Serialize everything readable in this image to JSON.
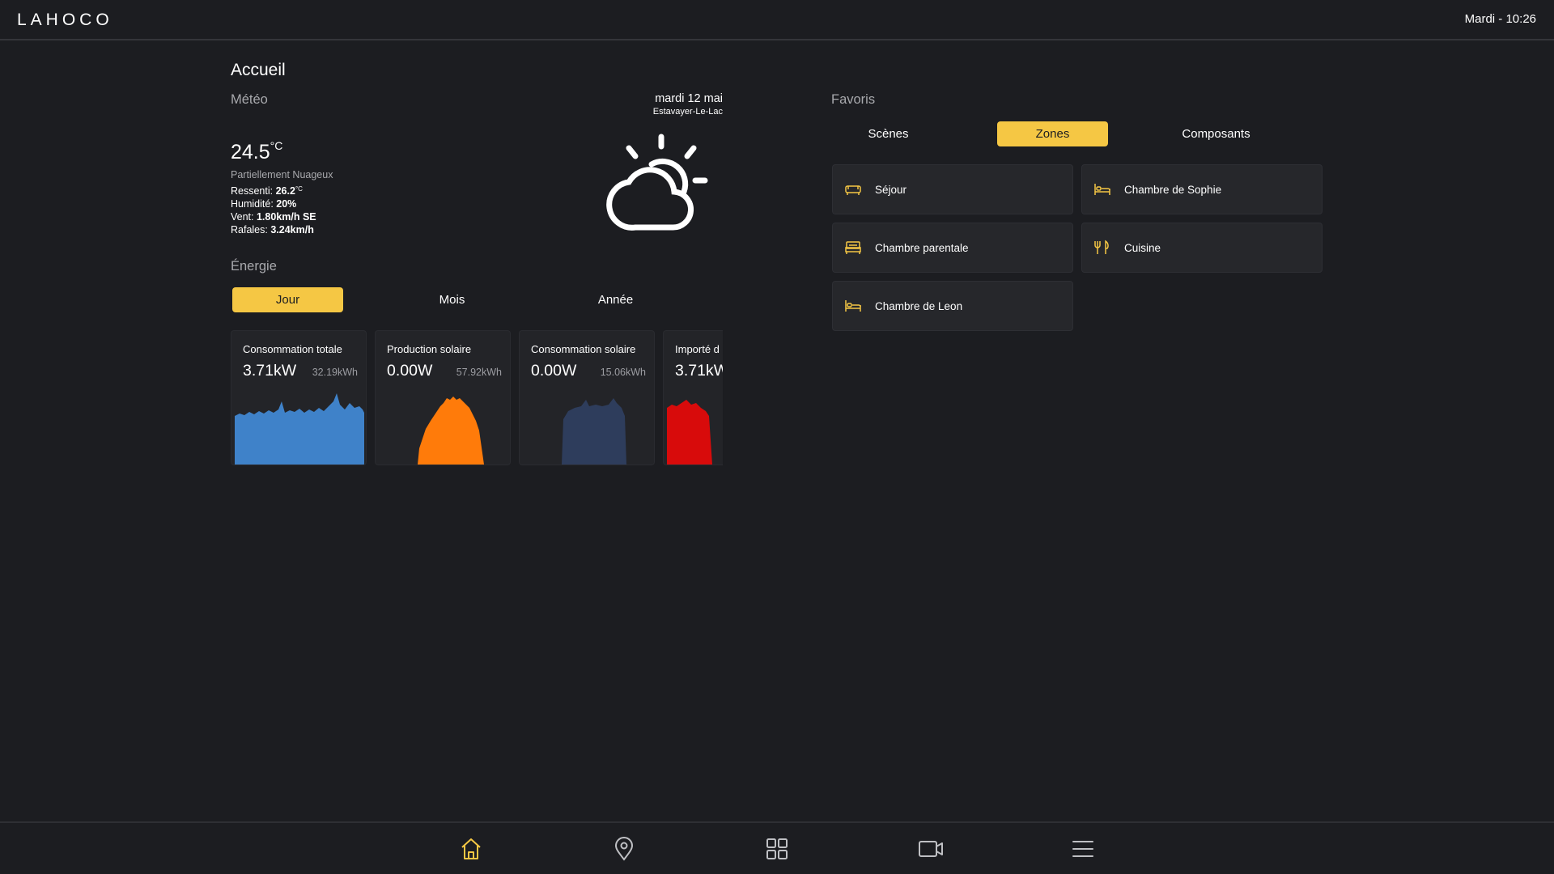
{
  "header": {
    "brand": "LAHOCO",
    "clock": "Mardi - 10:26"
  },
  "page": {
    "title": "Accueil"
  },
  "weather": {
    "section_title": "Météo",
    "date": "mardi 12 mai",
    "location": "Estavayer-Le-Lac",
    "temperature": "24.5",
    "temperature_unit": "°C",
    "description": "Partiellement Nuageux",
    "feels_label": "Ressenti: ",
    "feels_value": "26.2",
    "feels_unit": "°C",
    "humidity_label": "Humidité: ",
    "humidity_value": "20%",
    "wind_label": "Vent: ",
    "wind_value": "1.80km/h SE",
    "gusts_label": "Rafales: ",
    "gusts_value": "3.24km/h",
    "icon": "partly-cloudy-icon"
  },
  "energy": {
    "section_title": "Énergie",
    "tabs": [
      {
        "label": "Jour",
        "active": true
      },
      {
        "label": "Mois",
        "active": false
      },
      {
        "label": "Année",
        "active": false
      }
    ],
    "cards": [
      {
        "title": "Consommation totale",
        "value": "3.71kW",
        "sub": "32.19kWh",
        "color": "#3f82c9"
      },
      {
        "title": "Production solaire",
        "value": "0.00W",
        "sub": "57.92kWh",
        "color": "#ff7b0a"
      },
      {
        "title": "Consommation solaire",
        "value": "0.00W",
        "sub": "15.06kWh",
        "color": "#2e3d5c"
      },
      {
        "title": "Importé d",
        "value": "3.71kW",
        "sub": "",
        "color": "#d80b0b"
      }
    ]
  },
  "favorites": {
    "section_title": "Favoris",
    "tabs": [
      {
        "label": "Scènes",
        "active": false
      },
      {
        "label": "Zones",
        "active": true
      },
      {
        "label": "Composants",
        "active": false
      }
    ],
    "zones": [
      {
        "label": "Séjour",
        "icon": "sofa-icon"
      },
      {
        "label": "Chambre de Sophie",
        "icon": "bed-icon"
      },
      {
        "label": "Chambre parentale",
        "icon": "double-bed-icon"
      },
      {
        "label": "Cuisine",
        "icon": "cutlery-icon"
      },
      {
        "label": "Chambre de Leon",
        "icon": "bed-icon"
      }
    ]
  },
  "nav": [
    {
      "name": "home-icon",
      "active": true
    },
    {
      "name": "location-pin-icon",
      "active": false
    },
    {
      "name": "grid-icon",
      "active": false
    },
    {
      "name": "video-camera-icon",
      "active": false
    },
    {
      "name": "menu-icon",
      "active": false
    }
  ],
  "theme": {
    "accent": "#f5c744",
    "background": "#1c1d21"
  }
}
